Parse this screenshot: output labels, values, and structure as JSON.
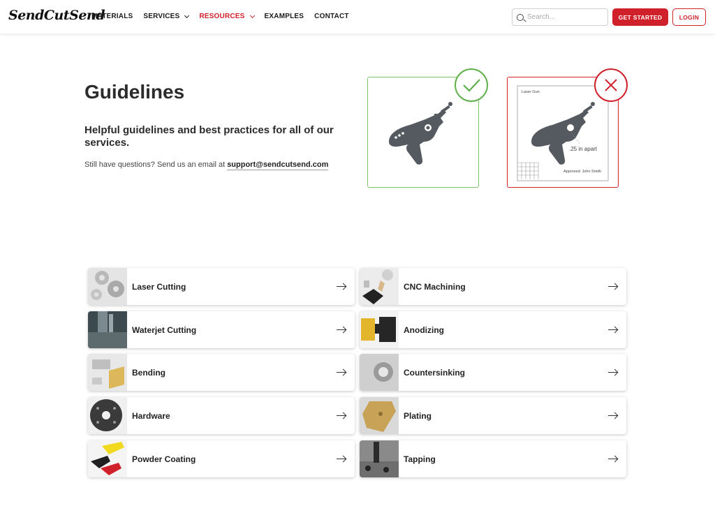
{
  "nav": {
    "logo": "SendCutSend",
    "items": [
      {
        "label": "MATERIALS",
        "has_dropdown": false,
        "active": false
      },
      {
        "label": "SERVICES",
        "has_dropdown": true,
        "active": false
      },
      {
        "label": "RESOURCES",
        "has_dropdown": true,
        "active": true
      },
      {
        "label": "EXAMPLES",
        "has_dropdown": false,
        "active": false
      },
      {
        "label": "CONTACT",
        "has_dropdown": false,
        "active": false
      }
    ],
    "search_placeholder": "Search...",
    "get_started": "GET STARTED",
    "login": "LOGIN"
  },
  "hero": {
    "title": "Guidelines",
    "subtitle": "Helpful guidelines and best practices for all of our services.",
    "question": "Still have questions? Send us an email at",
    "email": "support@sendcutsend.com"
  },
  "example_bad": {
    "part_name": "Laser Gun",
    "dimension_note": ".25 in apart",
    "approved": "Approved: John Smith"
  },
  "colors": {
    "brand_red": "#d0202a",
    "good_green": "#5fb04a"
  },
  "services": [
    {
      "label": "Laser Cutting",
      "thumb": "laser-cutting"
    },
    {
      "label": "CNC Machining",
      "thumb": "cnc-machining"
    },
    {
      "label": "Waterjet Cutting",
      "thumb": "waterjet-cutting"
    },
    {
      "label": "Anodizing",
      "thumb": "anodizing"
    },
    {
      "label": "Bending",
      "thumb": "bending"
    },
    {
      "label": "Countersinking",
      "thumb": "countersinking"
    },
    {
      "label": "Hardware",
      "thumb": "hardware"
    },
    {
      "label": "Plating",
      "thumb": "plating"
    },
    {
      "label": "Powder Coating",
      "thumb": "powder-coating"
    },
    {
      "label": "Tapping",
      "thumb": "tapping"
    }
  ]
}
